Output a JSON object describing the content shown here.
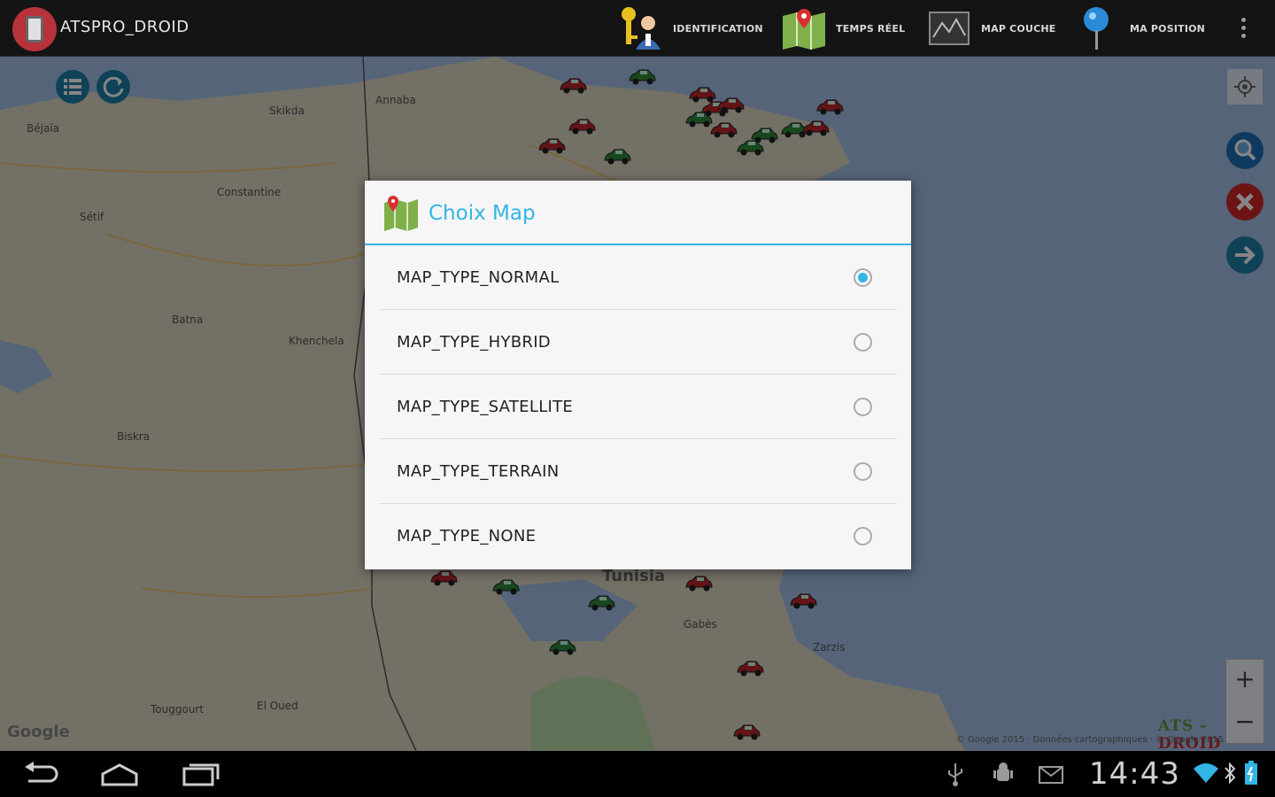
{
  "app": {
    "title": "ATSPRO_DROID",
    "actions": [
      {
        "label": "IDENTIFICATION",
        "icon": "keys-user-icon"
      },
      {
        "label": "TEMPS RÉEL",
        "icon": "map-pin-icon"
      },
      {
        "label": "MAP COUCHE",
        "icon": "map-layer-icon"
      },
      {
        "label": "MA POSITION",
        "icon": "blue-pushpin-icon"
      }
    ]
  },
  "map": {
    "labels": [
      "Skikda",
      "Annaba",
      "Béjaïa",
      "Constantine",
      "Sétif",
      "Batna",
      "Khenchela",
      "Biskra",
      "Tunisia",
      "Gabès",
      "Zarzis",
      "El Oued",
      "Touggourt"
    ],
    "google_logo": "Google",
    "watermark": {
      "left": "ATS - ",
      "right": "DROID"
    },
    "copyright": "© Google 2015 · Données cartographiques · © Google 2015",
    "zoom_in": "+",
    "zoom_out": "−",
    "vehicle_colors": {
      "moving": "#2e8b3a",
      "stopped": "#c0272d"
    }
  },
  "dialog": {
    "title": "Choix Map",
    "accent": "#33b5e5",
    "options": [
      {
        "label": "MAP_TYPE_NORMAL",
        "selected": true
      },
      {
        "label": "MAP_TYPE_HYBRID",
        "selected": false
      },
      {
        "label": "MAP_TYPE_SATELLITE",
        "selected": false
      },
      {
        "label": "MAP_TYPE_TERRAIN",
        "selected": false
      },
      {
        "label": "MAP_TYPE_NONE",
        "selected": false
      }
    ]
  },
  "statusbar": {
    "time": "14:43"
  }
}
